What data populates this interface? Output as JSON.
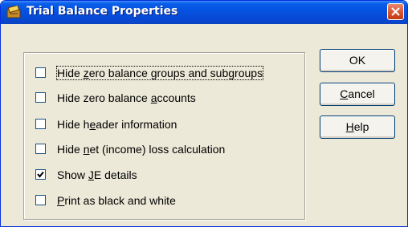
{
  "window": {
    "title": "Trial Balance Properties",
    "icon": "trial-balance-app-icon"
  },
  "options": [
    {
      "label_before": "Hide ",
      "mnemonic": "z",
      "label_after": "ero balance groups and subgroups",
      "checked": false
    },
    {
      "label_before": "Hide zero balance ",
      "mnemonic": "a",
      "label_after": "ccounts",
      "checked": false
    },
    {
      "label_before": "Hide h",
      "mnemonic": "e",
      "label_after": "ader information",
      "checked": false
    },
    {
      "label_before": "Hide ",
      "mnemonic": "n",
      "label_after": "et (income) loss calculation",
      "checked": false
    },
    {
      "label_before": "Show ",
      "mnemonic": "J",
      "label_after": "E details",
      "checked": true
    },
    {
      "label_before": "",
      "mnemonic": "P",
      "label_after": "rint as black and white",
      "checked": false
    }
  ],
  "buttons": {
    "ok": {
      "label": "OK"
    },
    "cancel": {
      "mnemonic": "C",
      "rest": "ancel"
    },
    "help": {
      "mnemonic": "H",
      "rest": "elp"
    }
  },
  "colors": {
    "titlebar": "#0551e0",
    "close": "#d9532f",
    "dialog_bg": "#ece9d8",
    "check": "#21a121"
  }
}
